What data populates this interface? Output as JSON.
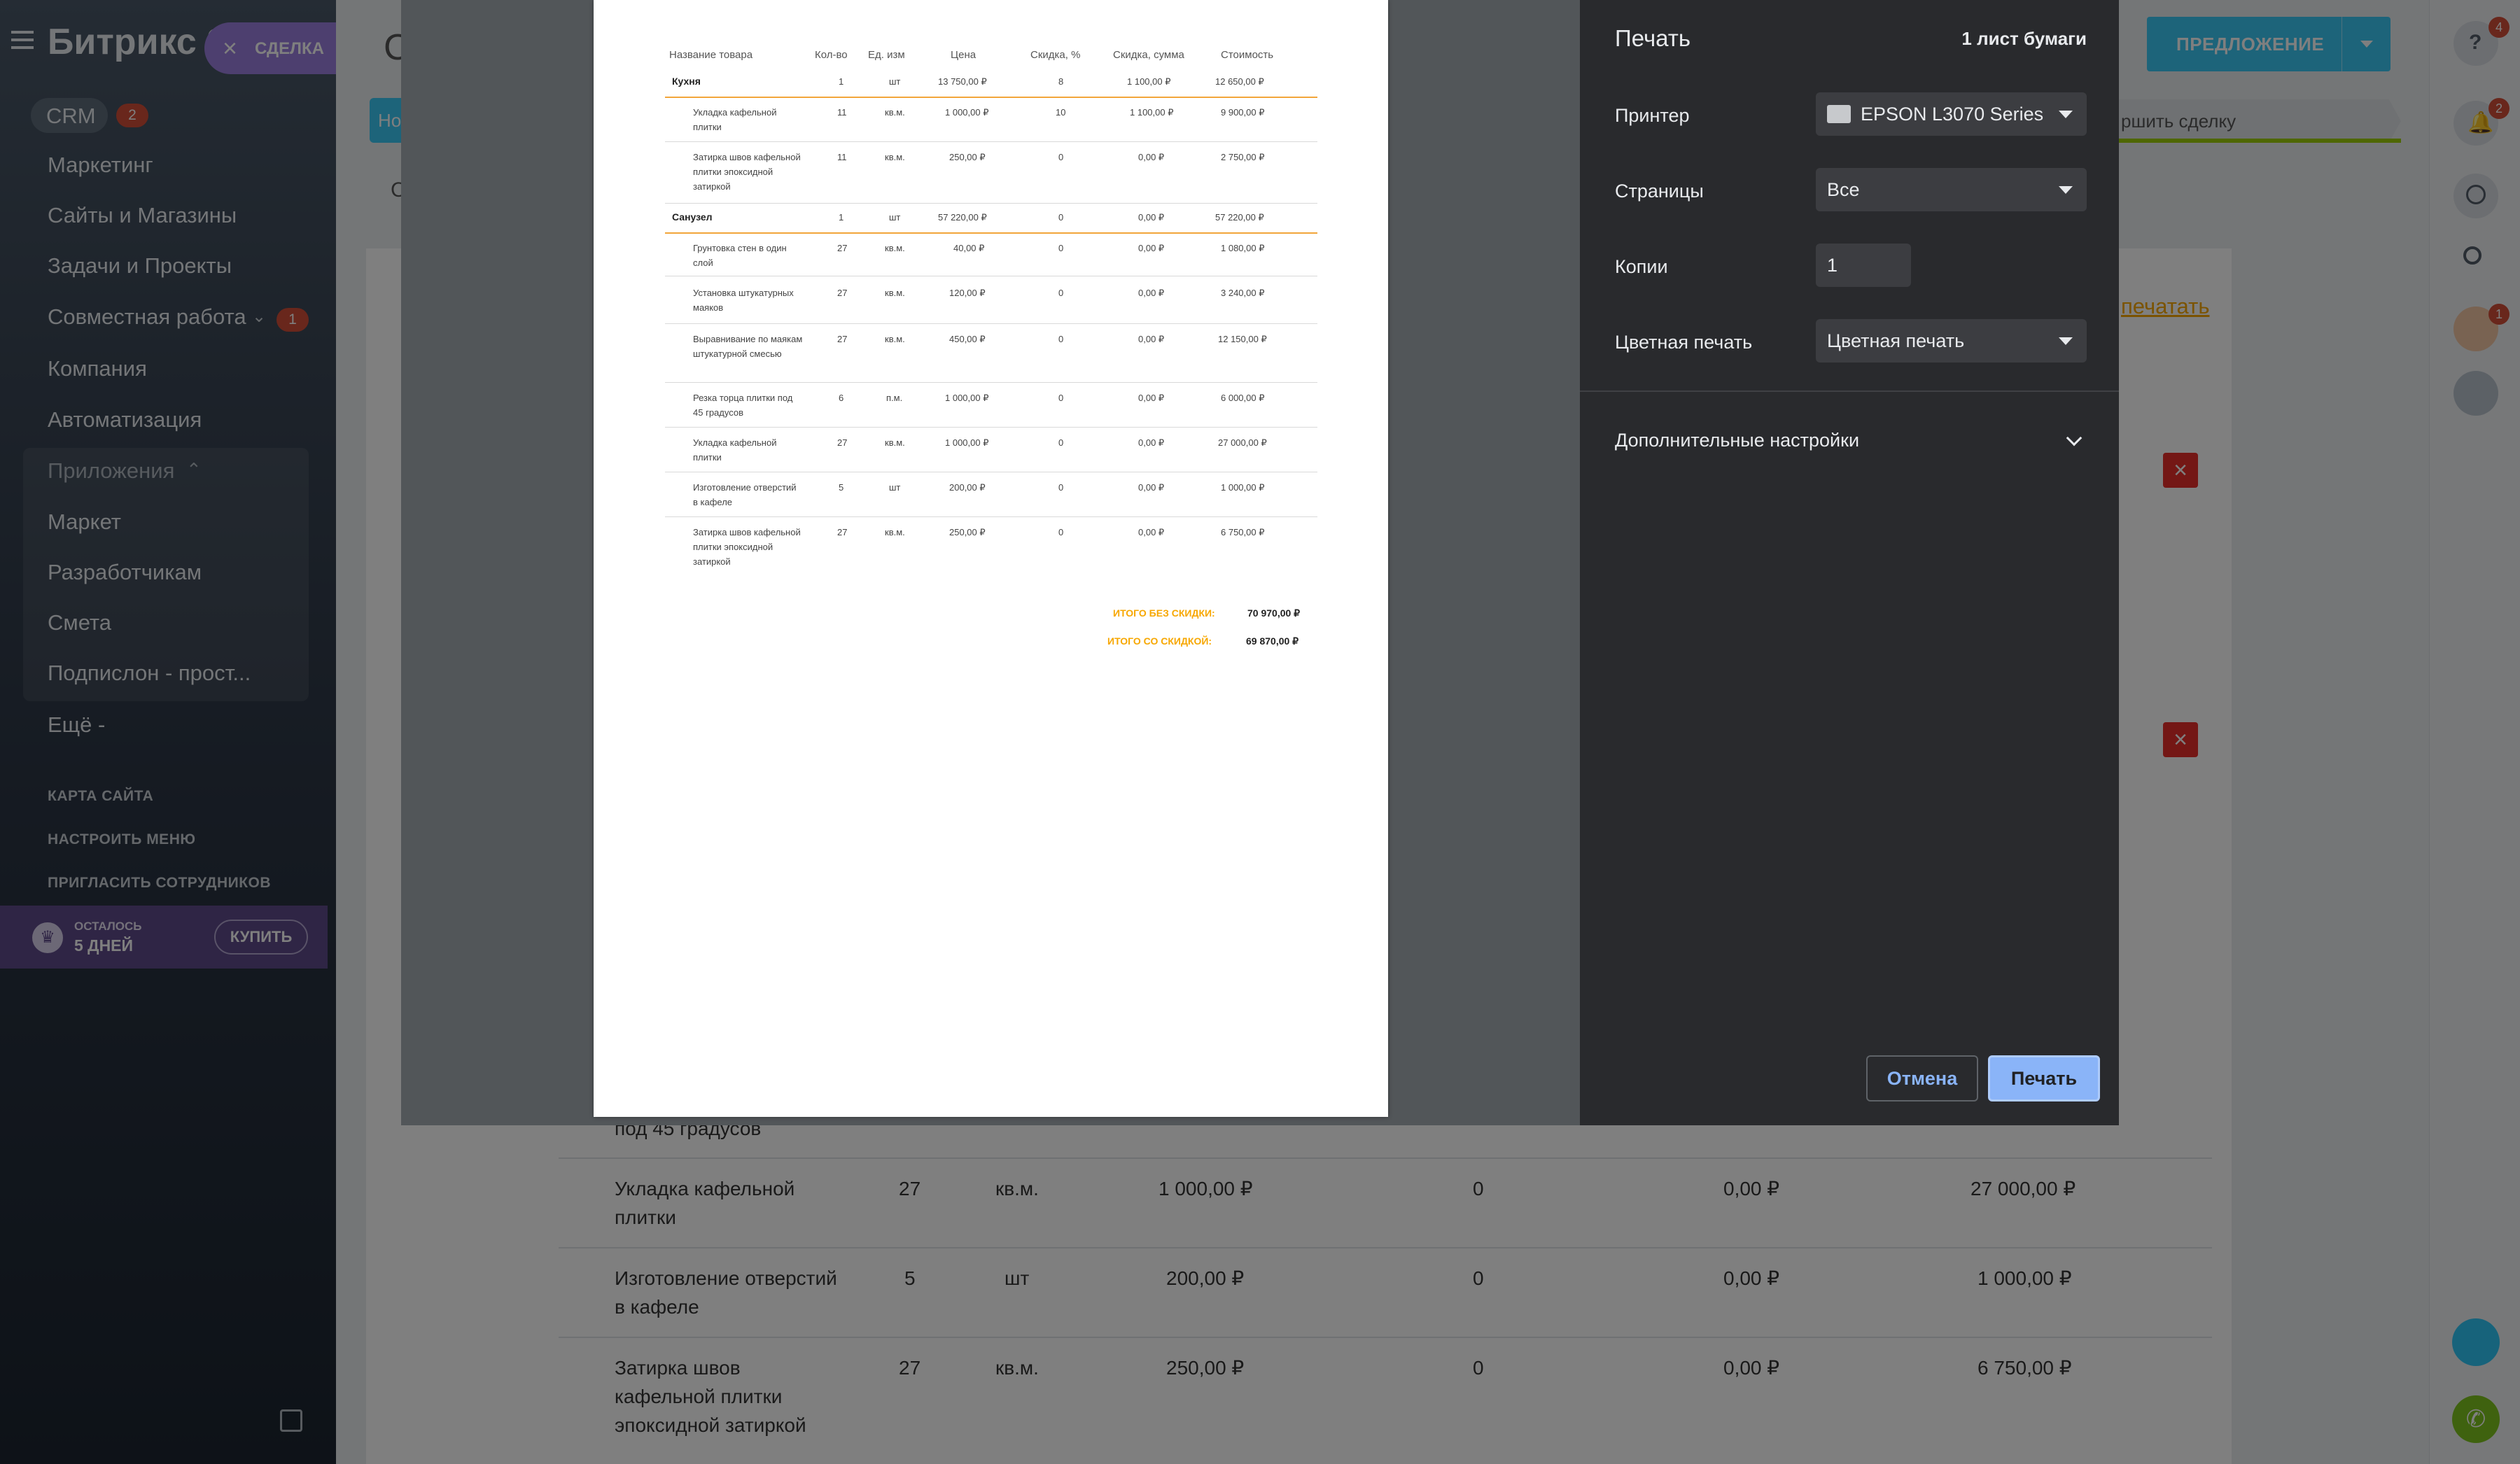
{
  "sidebar": {
    "logo": "Битрикс 2",
    "deal_chip": "СДЕЛКА",
    "crm_label": "CRM",
    "crm_badge": "2",
    "items": [
      "Маркетинг",
      "Сайты и Магазины",
      "Задачи и Проекты",
      "Совместная работа",
      "Компания",
      "Автоматизация",
      "Приложения",
      "Маркет",
      "Разработчикам",
      "Смета",
      "Подпислон - прост...",
      "Ещё -"
    ],
    "collab_badge": "1",
    "links": [
      "КАРТА САЙТА",
      "НАСТРОИТЬ МЕНЮ",
      "ПРИГЛАСИТЬ СОТРУДНИКОВ"
    ],
    "trial_line1": "ОСТАЛОСЬ",
    "trial_line2": "5 ДНЕЙ",
    "buy_label": "КУПИТЬ"
  },
  "header": {
    "proposal_button": "ПРЕДЛОЖЕНИЕ",
    "finish_deal": "ршить сделку",
    "print_link": "печатать",
    "tab_partial": "Но",
    "title_partial": "С",
    "subtitle_partial": "С"
  },
  "right_panel": {
    "help_badge": "4",
    "notify_badge": "2",
    "avatar_badge": "1"
  },
  "bg_table": {
    "partial_row": "под 45 градусов",
    "rows": [
      {
        "name": "Укладка кафельной плитки",
        "qty": "27",
        "unit": "кв.м.",
        "price": "1 000,00 ₽",
        "disc": "0",
        "disc_sum": "0,00 ₽",
        "total": "27 000,00 ₽"
      },
      {
        "name": "Изготовление отверстий в кафеле",
        "qty": "5",
        "unit": "шт",
        "price": "200,00 ₽",
        "disc": "0",
        "disc_sum": "0,00 ₽",
        "total": "1 000,00 ₽"
      },
      {
        "name": "Затирка швов кафельной плитки эпоксидной затиркой",
        "qty": "27",
        "unit": "кв.м.",
        "price": "250,00 ₽",
        "disc": "0",
        "disc_sum": "0,00 ₽",
        "total": "6 750,00 ₽"
      }
    ]
  },
  "print_dialog": {
    "title": "Печать",
    "sheets": "1 лист бумаги",
    "printer_label": "Принтер",
    "printer_value": "EPSON L3070 Series",
    "pages_label": "Страницы",
    "pages_value": "Все",
    "copies_label": "Копии",
    "copies_value": "1",
    "color_label": "Цветная печать",
    "color_value": "Цветная печать",
    "advanced_label": "Дополнительные настройки",
    "cancel_label": "Отмена",
    "print_label": "Печать"
  },
  "preview": {
    "headers": [
      "Название товара",
      "Кол-во",
      "Ед. изм",
      "Цена",
      "Скидка, %",
      "Скидка, сумма",
      "Стоимость"
    ],
    "sections": [
      {
        "name": "Кухня",
        "qty": "1",
        "unit": "шт",
        "price": "13 750,00 ₽",
        "disc": "8",
        "disc_sum": "1 100,00 ₽",
        "total": "12 650,00 ₽",
        "rows": [
          {
            "name": "Укладка кафельной плитки",
            "qty": "11",
            "unit": "кв.м.",
            "price": "1 000,00 ₽",
            "disc": "10",
            "disc_sum": "1 100,00 ₽",
            "total": "9 900,00 ₽"
          },
          {
            "name": "Затирка швов кафельной плитки эпоксидной затиркой",
            "qty": "11",
            "unit": "кв.м.",
            "price": "250,00 ₽",
            "disc": "0",
            "disc_sum": "0,00 ₽",
            "total": "2 750,00 ₽"
          }
        ]
      },
      {
        "name": "Санузел",
        "qty": "1",
        "unit": "шт",
        "price": "57 220,00 ₽",
        "disc": "0",
        "disc_sum": "0,00 ₽",
        "total": "57 220,00 ₽",
        "rows": [
          {
            "name": "Грунтовка стен в один слой",
            "qty": "27",
            "unit": "кв.м.",
            "price": "40,00 ₽",
            "disc": "0",
            "disc_sum": "0,00 ₽",
            "total": "1 080,00 ₽"
          },
          {
            "name": "Установка штукатурных маяков",
            "qty": "27",
            "unit": "кв.м.",
            "price": "120,00 ₽",
            "disc": "0",
            "disc_sum": "0,00 ₽",
            "total": "3 240,00 ₽"
          },
          {
            "name": "Выравнивание по маякам штукатурной смесью",
            "qty": "27",
            "unit": "кв.м.",
            "price": "450,00 ₽",
            "disc": "0",
            "disc_sum": "0,00 ₽",
            "total": "12 150,00 ₽"
          },
          {
            "name": "Резка торца плитки под 45 градусов",
            "qty": "6",
            "unit": "п.м.",
            "price": "1 000,00 ₽",
            "disc": "0",
            "disc_sum": "0,00 ₽",
            "total": "6 000,00 ₽"
          },
          {
            "name": "Укладка кафельной плитки",
            "qty": "27",
            "unit": "кв.м.",
            "price": "1 000,00 ₽",
            "disc": "0",
            "disc_sum": "0,00 ₽",
            "total": "27 000,00 ₽"
          },
          {
            "name": "Изготовление отверстий в кафеле",
            "qty": "5",
            "unit": "шт",
            "price": "200,00 ₽",
            "disc": "0",
            "disc_sum": "0,00 ₽",
            "total": "1 000,00 ₽"
          },
          {
            "name": "Затирка швов кафельной плитки эпоксидной затиркой",
            "qty": "27",
            "unit": "кв.м.",
            "price": "250,00 ₽",
            "disc": "0",
            "disc_sum": "0,00 ₽",
            "total": "6 750,00 ₽"
          }
        ]
      }
    ],
    "total_no_disc_label": "ИТОГО БЕЗ СКИДКИ:",
    "total_no_disc_value": "70 970,00 ₽",
    "total_disc_label": "ИТОГО СО СКИДКОЙ:",
    "total_disc_value": "69 870,00 ₽"
  },
  "colors": {
    "accent": "#2fc6f6",
    "orange": "#f7a700",
    "danger": "#e92f2a",
    "print_btn": "#8ab4f8"
  }
}
